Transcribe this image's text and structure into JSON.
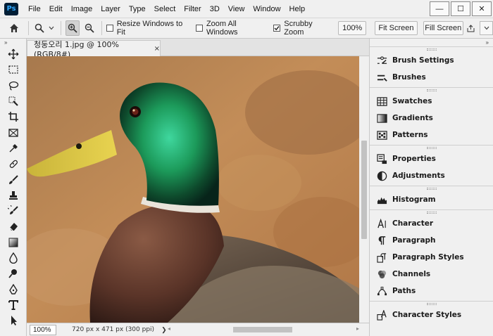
{
  "app": {
    "logo_text": "Ps"
  },
  "menu": [
    "File",
    "Edit",
    "Image",
    "Layer",
    "Type",
    "Select",
    "Filter",
    "3D",
    "View",
    "Window",
    "Help"
  ],
  "window_controls": {
    "minimize": "—",
    "maximize": "☐",
    "close": "✕"
  },
  "options": {
    "resize_windows_label": "Resize Windows to Fit",
    "resize_windows_checked": false,
    "zoom_all_label": "Zoom All Windows",
    "zoom_all_checked": false,
    "scrubby_zoom_label": "Scrubby Zoom",
    "scrubby_zoom_checked": true,
    "zoom_value": "100%",
    "fit_screen_label": "Fit Screen",
    "fill_screen_label": "Fill Screen"
  },
  "document": {
    "tab_title": "청둥오리 1.jpg @ 100% (RGB/8#)",
    "close_glyph": "×"
  },
  "status": {
    "zoom": "100%",
    "doc_info": "720 px x 471 px (300 ppi)",
    "arrow": "❯"
  },
  "tools": [
    "move-tool",
    "marquee-tool",
    "lasso-tool",
    "quick-select-tool",
    "crop-tool",
    "frame-tool",
    "eyedropper-tool",
    "healing-brush-tool",
    "brush-tool",
    "clone-stamp-tool",
    "history-brush-tool",
    "eraser-tool",
    "gradient-tool",
    "blur-tool",
    "dodge-tool",
    "pen-tool",
    "type-tool",
    "path-select-tool"
  ],
  "panels": {
    "group1": [
      "Brush Settings",
      "Brushes"
    ],
    "group2": [
      "Swatches",
      "Gradients",
      "Patterns"
    ],
    "group3": [
      "Properties",
      "Adjustments"
    ],
    "group4": [
      "Histogram"
    ],
    "group5": [
      "Character",
      "Paragraph",
      "Paragraph Styles",
      "Channels",
      "Paths"
    ],
    "group6": [
      "Character Styles"
    ]
  },
  "colors": {
    "accent": "#31a8ff",
    "logo_bg": "#001e36",
    "chrome": "#f0f0f0"
  }
}
